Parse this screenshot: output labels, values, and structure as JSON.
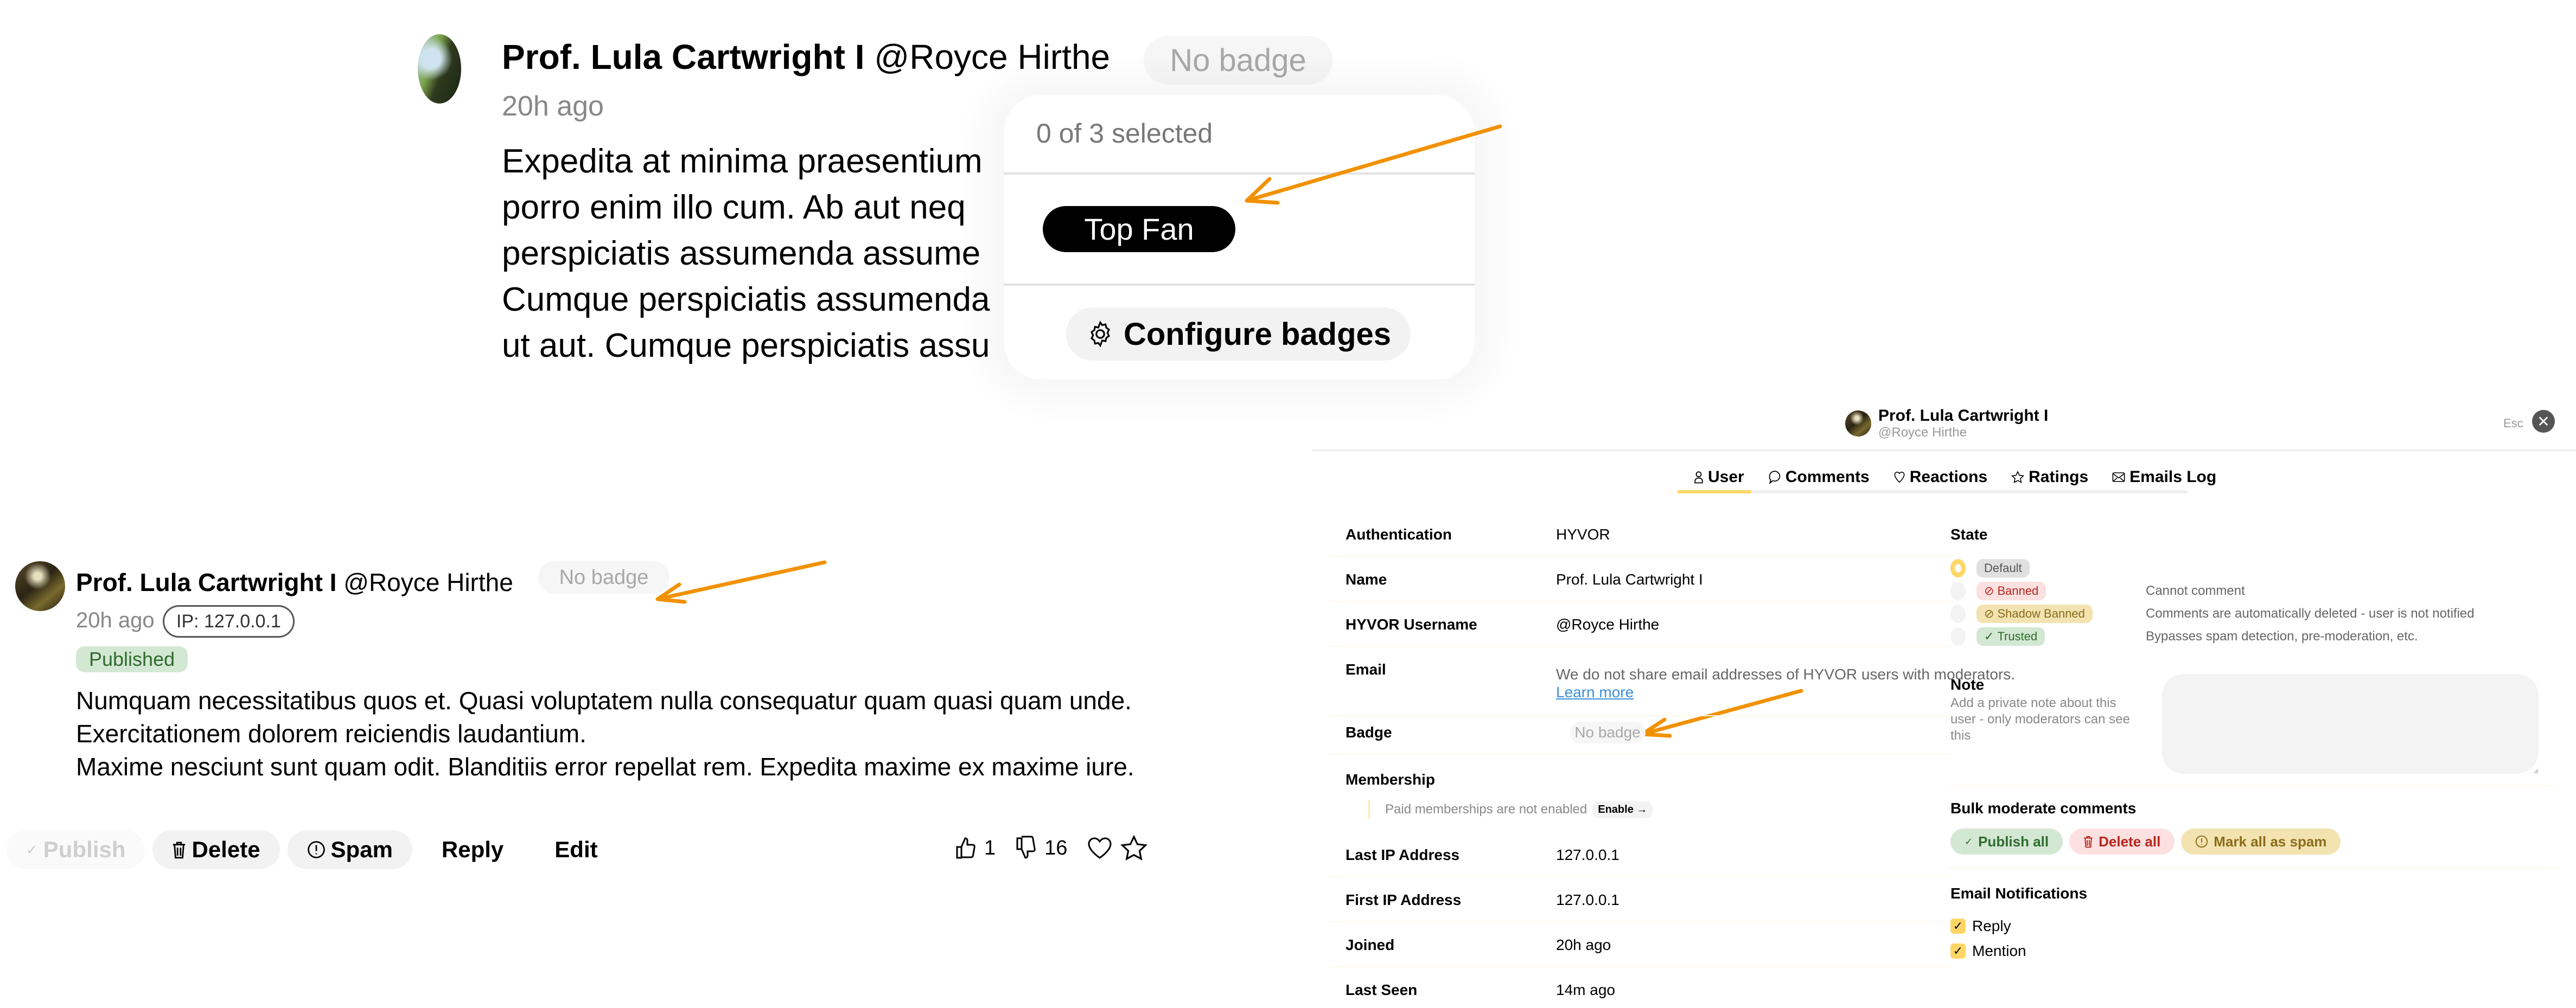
{
  "colors": {
    "accent_yellow": "#ffd666",
    "annotation_orange": "#f29100",
    "published_bg": "#d3e8d3",
    "published_fg": "#2f6b2f"
  },
  "zoomed_comment": {
    "author_name": "Prof. Lula Cartwright I",
    "author_handle": "@Royce Hirthe",
    "badge_button": "No badge",
    "time": "20h ago",
    "body_lines": [
      "Expedita at minima praesentium",
      "porro enim illo cum. Ab aut neq",
      "perspiciatis assumenda assume",
      "Cumque perspiciatis assumenda",
      "ut aut. Cumque perspiciatis assu"
    ],
    "badge_popover": {
      "selection_count": "0 of 3 selected",
      "badges": [
        "Top Fan"
      ],
      "configure_label": "Configure badges",
      "configure_icon": "gear-icon"
    }
  },
  "comment": {
    "author_name": "Prof. Lula Cartwright I",
    "author_handle": "@Royce Hirthe",
    "badge_button": "No badge",
    "time": "20h ago",
    "ip_label": "IP: 127.0.0.1",
    "status": "Published",
    "body": [
      "Numquam necessitatibus quos et. Quasi voluptatem nulla consequatur quam quasi quam unde. Exercitationem dolorem reiciendis laudantium.",
      "Maxime nesciunt sunt quam odit. Blanditiis error repellat rem. Expedita maxime ex maxime iure."
    ],
    "actions": {
      "publish": "Publish",
      "delete": "Delete",
      "spam": "Spam",
      "reply": "Reply",
      "edit": "Edit"
    },
    "reactions": {
      "upvotes": "1",
      "downvotes": "16"
    }
  },
  "user_panel": {
    "name": "Prof. Lula Cartwright I",
    "handle": "@Royce Hirthe",
    "esc_label": "Esc",
    "tabs": [
      {
        "label": "User",
        "icon": "user-icon",
        "active": true
      },
      {
        "label": "Comments",
        "icon": "comment-icon",
        "active": false
      },
      {
        "label": "Reactions",
        "icon": "heart-icon",
        "active": false
      },
      {
        "label": "Ratings",
        "icon": "star-icon",
        "active": false
      },
      {
        "label": "Emails Log",
        "icon": "envelope-icon",
        "active": false
      }
    ],
    "fields": {
      "authentication": {
        "label": "Authentication",
        "value": "HYVOR"
      },
      "name": {
        "label": "Name",
        "value": "Prof. Lula Cartwright I"
      },
      "username": {
        "label": "HYVOR Username",
        "value": "@Royce Hirthe"
      },
      "email": {
        "label": "Email",
        "note": "We do not share email addresses of HYVOR users with moderators.",
        "link": "Learn more"
      },
      "badge": {
        "label": "Badge",
        "value": "No badge"
      },
      "membership": {
        "label": "Membership",
        "note": "Paid memberships are not enabled",
        "enable_label": "Enable →"
      },
      "last_ip": {
        "label": "Last IP Address",
        "value": "127.0.0.1"
      },
      "first_ip": {
        "label": "First IP Address",
        "value": "127.0.0.1"
      },
      "joined": {
        "label": "Joined",
        "value": "20h ago"
      },
      "last_seen": {
        "label": "Last Seen",
        "value": "14m ago"
      }
    },
    "state": {
      "title": "State",
      "selected": "Default",
      "options": [
        {
          "label": "Default",
          "description": ""
        },
        {
          "label": "Banned",
          "description": "Cannot comment"
        },
        {
          "label": "Shadow Banned",
          "description": "Comments are automatically deleted - user is not notified"
        },
        {
          "label": "Trusted",
          "description": "Bypasses spam detection, pre-moderation, etc."
        }
      ]
    },
    "note": {
      "title": "Note",
      "description": "Add a private note about this user - only moderators can see this",
      "value": ""
    },
    "bulk": {
      "title": "Bulk moderate comments",
      "publish_all": "Publish all",
      "delete_all": "Delete all",
      "mark_spam": "Mark all as spam"
    },
    "notifications": {
      "title": "Email Notifications",
      "items": [
        {
          "label": "Reply",
          "checked": true
        },
        {
          "label": "Mention",
          "checked": true
        }
      ]
    }
  }
}
